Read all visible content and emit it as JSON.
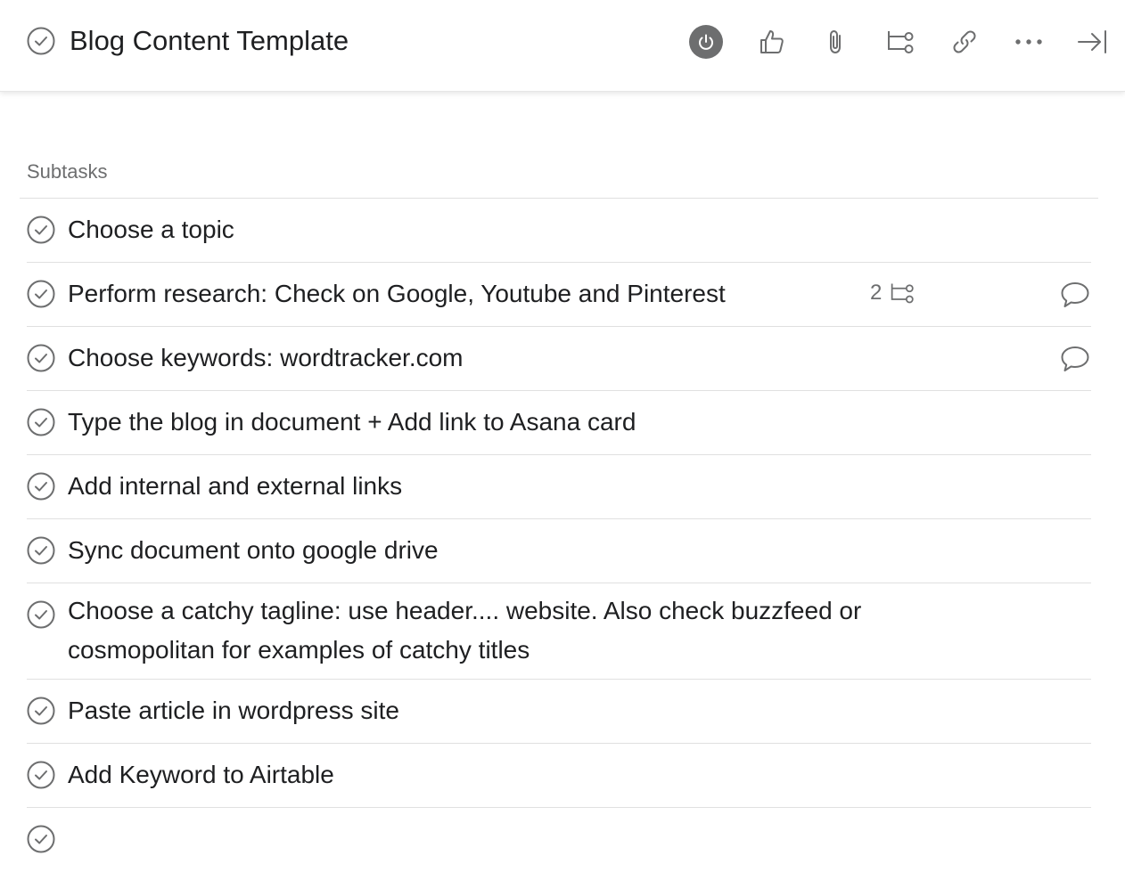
{
  "task": {
    "title": "Blog Content Template"
  },
  "toolbar": {
    "icons": [
      "power-icon",
      "thumbs-up-icon",
      "paperclip-icon",
      "subtask-icon",
      "link-icon",
      "more-icon",
      "close-panel-icon"
    ],
    "power_bg": "#6d6e6f"
  },
  "subtasks": {
    "label": "Subtasks",
    "items": [
      {
        "label": "Choose a topic"
      },
      {
        "label": "Perform research: Check on Google, Youtube and Pinterest",
        "subtask_count": "2",
        "has_comment": true
      },
      {
        "label": "Choose keywords: wordtracker.com",
        "has_comment": true
      },
      {
        "label": "Type the blog in document + Add link to Asana card"
      },
      {
        "label": "Add internal and external links"
      },
      {
        "label": "Sync document onto google drive"
      },
      {
        "label": "Choose a catchy tagline: use header.... website. Also check buzzfeed or cosmopolitan for examples of catchy titles"
      },
      {
        "label": "Paste article in wordpress site"
      },
      {
        "label": "Add Keyword to Airtable"
      }
    ]
  },
  "colors": {
    "text": "#1e1f21",
    "muted": "#6d6e6f",
    "divider": "#e0e0e0"
  }
}
